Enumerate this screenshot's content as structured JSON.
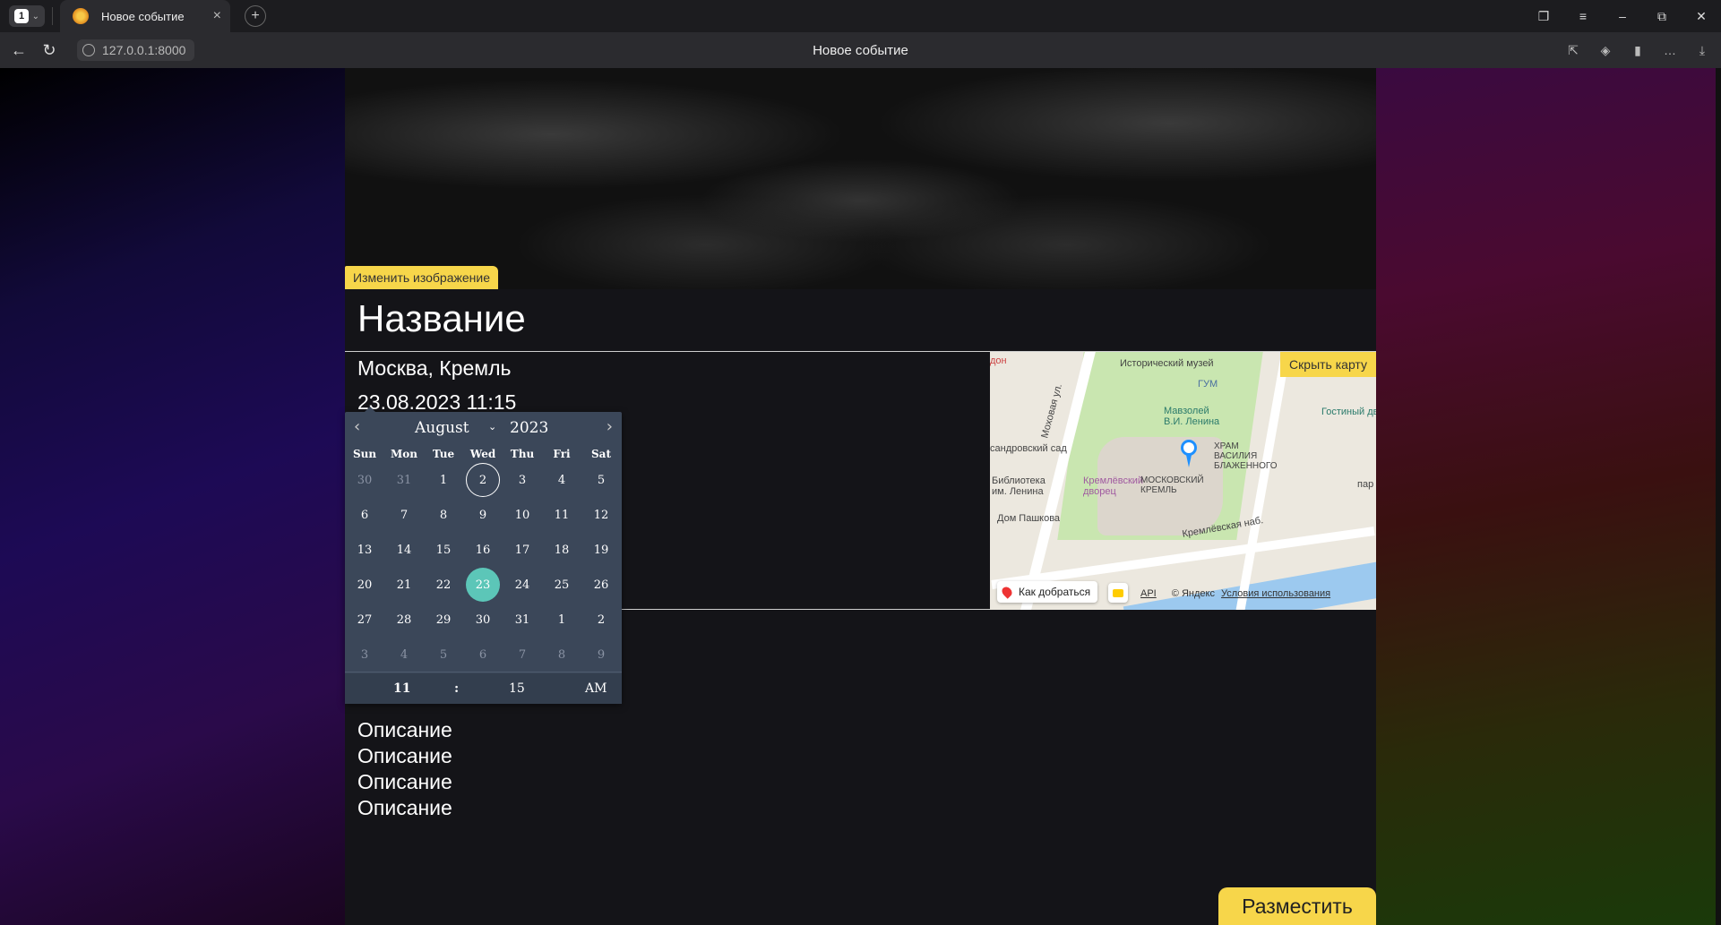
{
  "browser": {
    "tab_count": "1",
    "tab_title": "Новое событие",
    "url": "127.0.0.1:8000",
    "page_title": "Новое событие"
  },
  "event": {
    "change_image_label": "Изменить изображение",
    "title": "Название",
    "place": "Москва, Кремль",
    "datetime": "23.08.2023 11:15",
    "description_lines": [
      "Описание",
      "Описание",
      "Описание",
      "Описание"
    ],
    "publish_label": "Разместить"
  },
  "map": {
    "hide_label": "Скрыть карту",
    "route_label": "Как добраться",
    "attribution": "© Яндекс",
    "terms": "Условия использования",
    "api": "API",
    "labels": {
      "museum": "Исторический музей",
      "gum": "ГУМ",
      "gostiny": "Гостиный дв",
      "mausoleum": "Мавзолей В.И. Ленина",
      "aleksandrovsky": "сандровский сад",
      "library": "Библиотека им. Ленина",
      "kremlin_palace": "Кремлёвский дворец",
      "moscow_kremlin": "МОСКОВСКИЙ КРЕМЛЬ",
      "st_basil": "ХРАМ ВАСИЛИЯ БЛАЖЕННОГО",
      "pashkov": "Дом Пашкова",
      "embankment": "Кремлёвская наб.",
      "mokhovaya": "Моховая ул.",
      "don": "дон",
      "par": "пар"
    }
  },
  "calendar": {
    "month": "August",
    "year": "2023",
    "weekdays": [
      "Sun",
      "Mon",
      "Tue",
      "Wed",
      "Thu",
      "Fri",
      "Sat"
    ],
    "days": [
      "30",
      "31",
      "1",
      "2",
      "3",
      "4",
      "5",
      "6",
      "7",
      "8",
      "9",
      "10",
      "11",
      "12",
      "13",
      "14",
      "15",
      "16",
      "17",
      "18",
      "19",
      "20",
      "21",
      "22",
      "23",
      "24",
      "25",
      "26",
      "27",
      "28",
      "29",
      "30",
      "31",
      "1",
      "2",
      "3",
      "4",
      "5",
      "6",
      "7",
      "8",
      "9"
    ],
    "hour": "11",
    "colon": ":",
    "minute": "15",
    "ampm": "AM"
  }
}
